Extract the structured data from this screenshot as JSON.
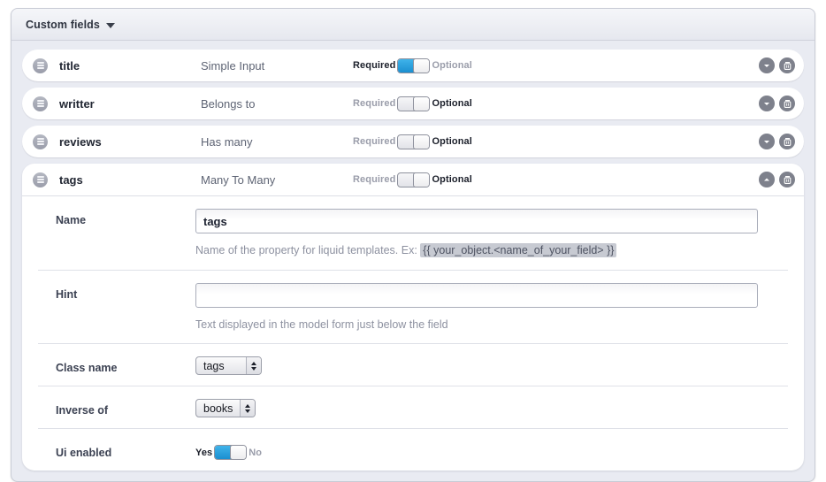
{
  "panel": {
    "title": "Custom fields",
    "disclosure_icon": "triangle-down-icon"
  },
  "toggle": {
    "required_label": "Required",
    "optional_label": "Optional",
    "yes_label": "Yes",
    "no_label": "No"
  },
  "icons": {
    "drag_handle": "drag-handle-icon",
    "collapse": "chevron-up-icon",
    "expand": "chevron-down-icon",
    "delete": "trash-icon"
  },
  "colors": {
    "toggle_on": "#1b8fd0",
    "panel_bg": "#e9ebf2",
    "card_bg": "#ffffff",
    "label_text": "#3b4152",
    "muted_text": "#8d91a0"
  },
  "fields": [
    {
      "name": "title",
      "type": "Simple Input",
      "required": true,
      "expanded": false
    },
    {
      "name": "writter",
      "type": "Belongs to",
      "required": false,
      "expanded": false
    },
    {
      "name": "reviews",
      "type": "Has many",
      "required": false,
      "expanded": false
    },
    {
      "name": "tags",
      "type": "Many To Many",
      "required": false,
      "expanded": true
    }
  ],
  "expanded_field": {
    "name_row": {
      "label": "Name",
      "value": "tags",
      "placeholder": "",
      "help_prefix": "Name of the property for liquid templates. Ex:",
      "help_code": "{{ your_object.<name_of_your_field> }}"
    },
    "hint_row": {
      "label": "Hint",
      "value": "",
      "placeholder": "",
      "help": "Text displayed in the model form just below the field"
    },
    "class_name_row": {
      "label": "Class name",
      "value": "tags"
    },
    "inverse_of_row": {
      "label": "Inverse of",
      "value": "books"
    },
    "ui_enabled_row": {
      "label": "Ui enabled",
      "enabled": true
    }
  }
}
